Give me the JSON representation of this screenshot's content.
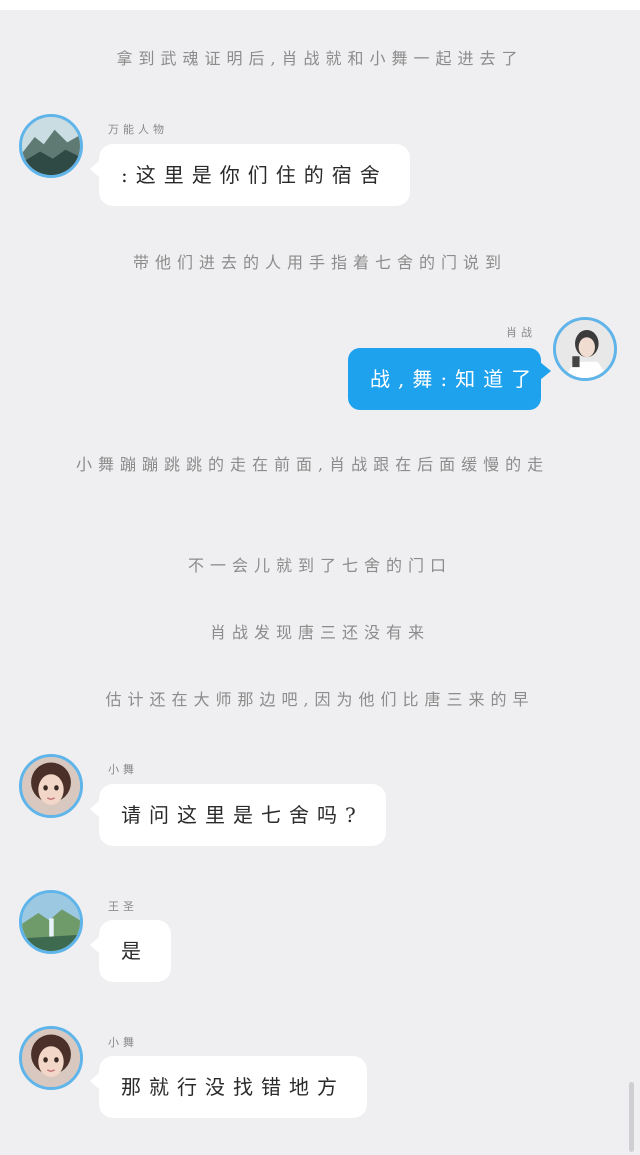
{
  "narrations": [
    "拿到武魂证明后,肖战就和小舞一起进去了",
    "带他们进去的人用手指着七舍的门说到",
    "小舞蹦蹦跳跳的走在前面,肖战跟在后面缓慢的走",
    "不一会儿就到了七舍的门口",
    "肖战发现唐三还没有来",
    "估计还在大师那边吧,因为他们比唐三来的早"
  ],
  "messages": [
    {
      "sender": "万能人物",
      "text": ":这里是你们住的宿舍",
      "side": "left",
      "avatar": "mountain-landscape-avatar"
    },
    {
      "sender": "肖战",
      "text": "战,舞:知道了",
      "side": "right",
      "avatar": "person-portrait-avatar"
    },
    {
      "sender": "小舞",
      "text": "请问这里是七舍吗?",
      "side": "left",
      "avatar": "girl-portrait-avatar"
    },
    {
      "sender": "王圣",
      "text": "是",
      "side": "left",
      "avatar": "waterfall-landscape-avatar"
    },
    {
      "sender": "小舞",
      "text": "那就行没找错地方",
      "side": "left",
      "avatar": "girl-portrait-avatar"
    }
  ],
  "colors": {
    "background": "#efeff1",
    "bubble_left": "#ffffff",
    "bubble_right": "#1ea2ee",
    "avatar_border": "#5fb4ea",
    "narration_text": "#8c8c8c"
  }
}
